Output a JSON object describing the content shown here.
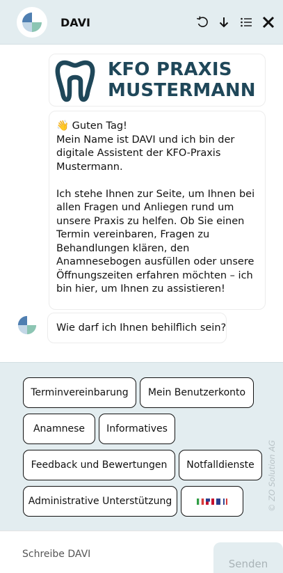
{
  "header": {
    "title": "DAVI",
    "icons": [
      "logo-icon",
      "undo-icon",
      "download-icon",
      "menu-list-icon",
      "close-icon"
    ]
  },
  "logo": {
    "line1": "KFO PRAXIS",
    "line2": "MUSTERMANN",
    "brand_color": "#1f4759"
  },
  "messages": {
    "greeting": "👋 Guten Tag!\nMein Name ist DAVI und ich bin der digitale Assistent der KFO-Praxis Mustermann.\n\nIch stehe Ihnen zur Seite, um Ihnen bei allen Fragen und Anliegen rund um unsere Praxis zu helfen. Ob Sie einen Termin vereinbaren, Fragen zu Behandlungen klären, den Anamnesebogen ausfüllen oder unsere Öffnungszeiten erfahren möchten – ich bin hier, um Ihnen zu assistieren!",
    "question": "Wie darf ich Ihnen behilflich sein?"
  },
  "quick_replies": {
    "terminvereinbarung": "Terminvereinbarung",
    "benutzerkonto": "Mein Benutzerkonto",
    "anamnese": "Anamnese",
    "informatives": "Informatives",
    "feedback": "Feedback und Bewertungen",
    "notfall": "Notfalldienste",
    "administrative": "Administrative Unterstützung",
    "language_icon": "flags-icon"
  },
  "watermark": "© ZO Solution AG",
  "composer": {
    "placeholder": "Schreibe DAVI",
    "send_label": "Senden"
  },
  "colors": {
    "panel_bg": "#e3edf0",
    "logo_blue": "#4f7fb1",
    "logo_green": "#8cc5b3"
  }
}
